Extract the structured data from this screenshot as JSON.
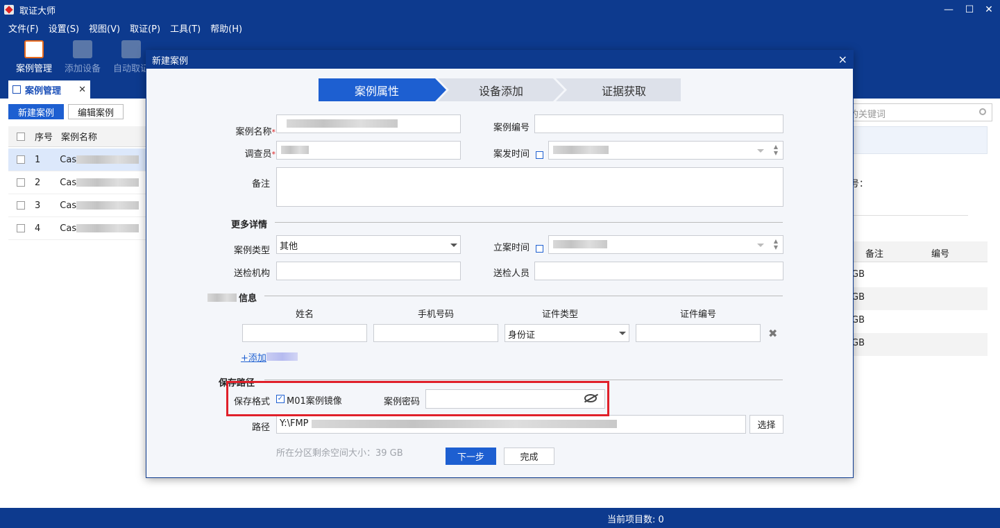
{
  "window": {
    "title": "取证大师",
    "controls": {
      "minimize": "—",
      "maximize": "☐",
      "close": "✕"
    }
  },
  "menu": [
    "文件(F)",
    "设置(S)",
    "视图(V)",
    "取证(P)",
    "工具(T)",
    "帮助(H)"
  ],
  "toolbar": {
    "case_manage": "案例管理",
    "add_device": "添加设备",
    "auto_forensics": "自动取证"
  },
  "tab": {
    "label": "案例管理",
    "close": "✕"
  },
  "case_list": {
    "new_button": "新建案例",
    "edit_button": "编辑案例",
    "columns": {
      "index": "序号",
      "name": "案例名称"
    },
    "rows": [
      {
        "index": "1",
        "name_prefix": "Cas"
      },
      {
        "index": "2",
        "name_prefix": "Cas"
      },
      {
        "index": "3",
        "name_prefix": "Cas"
      },
      {
        "index": "4",
        "name_prefix": "Cas"
      }
    ]
  },
  "right_panel": {
    "search_placeholder": "的关键词",
    "field_partial": "号：",
    "columns": {
      "note": "备注",
      "id": "编号"
    },
    "size_cells": [
      "GB",
      "GB",
      "GB",
      "GB"
    ]
  },
  "status": {
    "count": "当前项目数: 0"
  },
  "dialog": {
    "title": "新建案例",
    "close": "×",
    "steps": [
      "案例属性",
      "设备添加",
      "证据获取"
    ],
    "active_step": 0,
    "fields": {
      "case_name": "案例名称",
      "case_number": "案例编号",
      "investigator": "调查员",
      "incident_time": "案发时间",
      "notes": "备注",
      "required_mark": "*"
    },
    "more_details": {
      "heading": "更多详情",
      "case_type_label": "案例类型",
      "case_type_value": "其他",
      "filing_time_label": "立案时间",
      "submit_org_label": "送检机构",
      "submit_person_label": "送检人员"
    },
    "person_info": {
      "heading_suffix": "信息",
      "columns": [
        "姓名",
        "手机号码",
        "证件类型",
        "证件编号"
      ],
      "id_type_value": "身份证",
      "add_link_prefix": "+添加"
    },
    "save_path": {
      "heading": "保存路径",
      "format_label": "保存格式",
      "format_option": "M01案例镜像",
      "format_checked": true,
      "password_label": "案例密码",
      "path_label": "路径",
      "path_value_prefix": "Y:\\FMP",
      "choose_button": "选择",
      "free_space": "所在分区剩余空间大小：39 GB"
    },
    "buttons": {
      "next": "下一步",
      "finish": "完成"
    }
  }
}
